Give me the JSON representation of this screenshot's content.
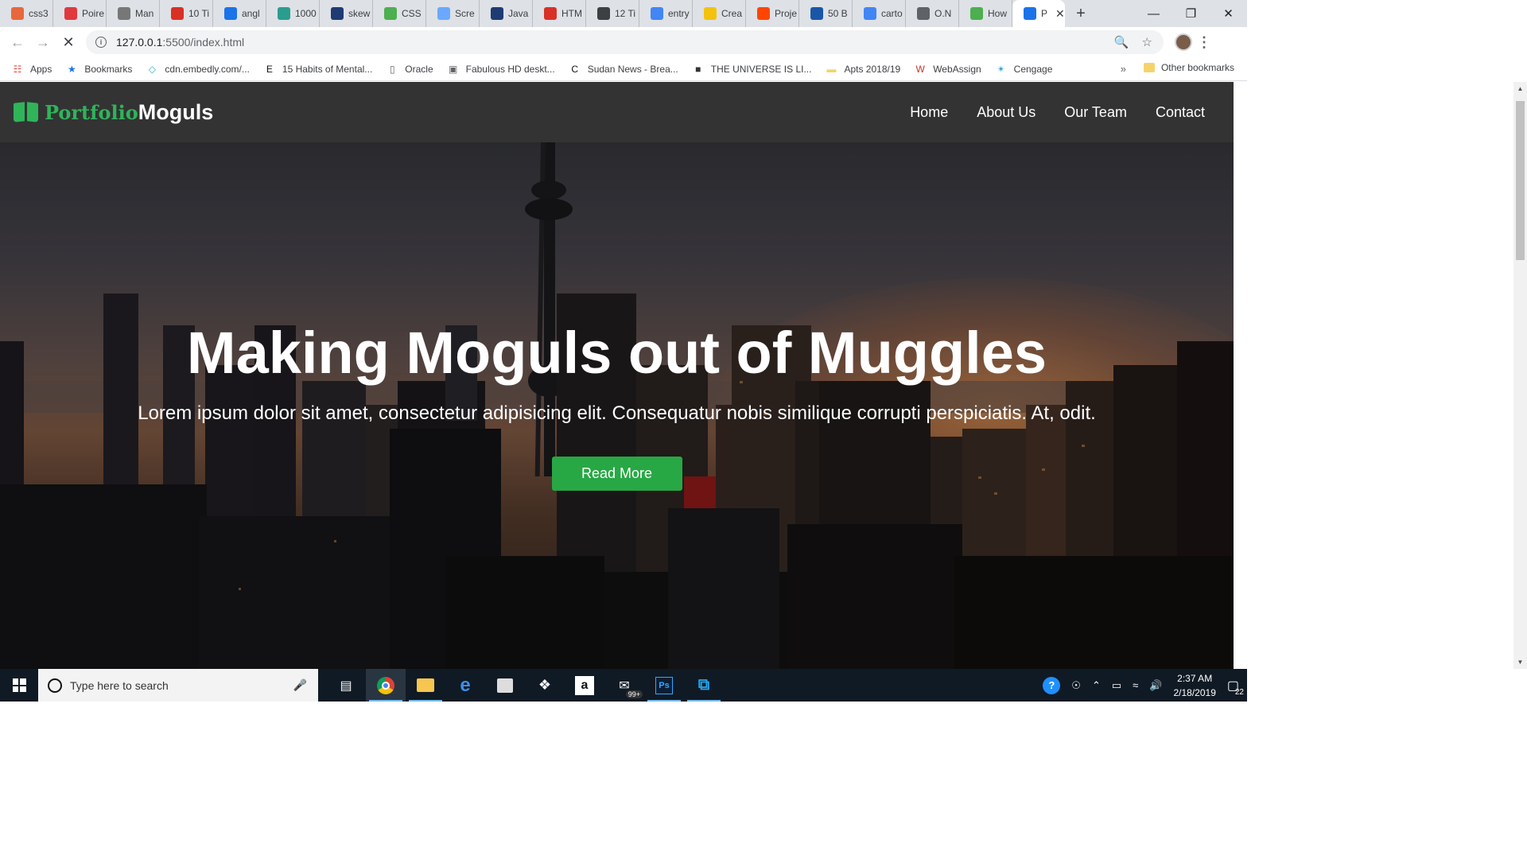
{
  "browser": {
    "tabs": [
      {
        "label": "css3",
        "icon": "firefox-like-icon",
        "color": "#e8673c"
      },
      {
        "label": "Poire",
        "icon": "f-icon",
        "color": "#e0393e"
      },
      {
        "label": "Man",
        "icon": "robot-icon",
        "color": "#777777"
      },
      {
        "label": "10 Ti",
        "icon": "red-swirl-icon",
        "color": "#d93025"
      },
      {
        "label": "angl",
        "icon": "flag-icon",
        "color": "#1a73e8"
      },
      {
        "label": "1000",
        "icon": "d-icon",
        "color": "#2a9d8f"
      },
      {
        "label": "skew",
        "icon": "fish-icon",
        "color": "#1f3b73"
      },
      {
        "label": "CSS",
        "icon": "w3-icon",
        "color": "#4caf50"
      },
      {
        "label": "Scre",
        "icon": "circle-icon",
        "color": "#6aa9ff"
      },
      {
        "label": "Java",
        "icon": "q-icon",
        "color": "#1f3b73"
      },
      {
        "label": "HTM",
        "icon": "opera-icon",
        "color": "#d93025"
      },
      {
        "label": "12 Ti",
        "icon": "image-icon",
        "color": "#3c4043"
      },
      {
        "label": "entry",
        "icon": "google-icon",
        "color": "#4285f4"
      },
      {
        "label": "Crea",
        "icon": "yellow-i-icon",
        "color": "#f4c20d"
      },
      {
        "label": "Proje",
        "icon": "reddit-icon",
        "color": "#ff4500"
      },
      {
        "label": "50 B",
        "icon": "fx-icon",
        "color": "#1a56a8"
      },
      {
        "label": "carto",
        "icon": "google-icon",
        "color": "#4285f4"
      },
      {
        "label": "O.N",
        "icon": "page-icon",
        "color": "#5f6368"
      },
      {
        "label": "How",
        "icon": "w3-icon",
        "color": "#4caf50"
      },
      {
        "label": "P",
        "icon": "loading-icon",
        "color": "#1a73e8"
      }
    ],
    "new_tab": "+",
    "window_controls": {
      "minimize": "—",
      "restore": "❐",
      "close": "✕"
    },
    "url_host": "127.0.0.1",
    "url_rest": ":5500/index.html",
    "bookmarks": [
      {
        "label": "Apps",
        "icon": "apps-grid-icon"
      },
      {
        "label": "Bookmarks",
        "icon": "star-icon"
      },
      {
        "label": "cdn.embedly.com/...",
        "icon": "embedly-icon"
      },
      {
        "label": "15 Habits of Mental...",
        "icon": "e-icon"
      },
      {
        "label": "Oracle",
        "icon": "page-icon"
      },
      {
        "label": "Fabulous HD deskt...",
        "icon": "image-icon"
      },
      {
        "label": "Sudan News - Brea...",
        "icon": "c-icon"
      },
      {
        "label": "THE UNIVERSE IS LI...",
        "icon": "photo-icon"
      },
      {
        "label": "Apts 2018/19",
        "icon": "folder-icon"
      },
      {
        "label": "WebAssign",
        "icon": "wa-icon"
      },
      {
        "label": "Cengage",
        "icon": "cengage-icon"
      }
    ],
    "bookmarks_more": "»",
    "other_bookmarks": "Other bookmarks"
  },
  "site": {
    "logo_part1": "Portfolio",
    "logo_part2": "Moguls",
    "nav": [
      "Home",
      "About Us",
      "Our Team",
      "Contact"
    ],
    "hero_title": "Making Moguls out of Muggles",
    "hero_subtitle": "Lorem ipsum dolor sit amet, consectetur adipisicing elit. Consequatur nobis similique corrupti perspiciatis. At, odit.",
    "hero_button": "Read More",
    "colors": {
      "accent": "#28a745",
      "nav_bg": "#333333"
    }
  },
  "taskbar": {
    "search_placeholder": "Type here to search",
    "apps": [
      "task-view-icon",
      "chrome-icon",
      "file-explorer-icon",
      "edge-icon",
      "store-icon",
      "dropbox-icon",
      "amazon-icon",
      "mail-icon",
      "photoshop-icon",
      "vscode-icon"
    ],
    "mail_badge": "99+",
    "time": "2:37 AM",
    "date": "2/18/2019",
    "notifications": "22"
  }
}
